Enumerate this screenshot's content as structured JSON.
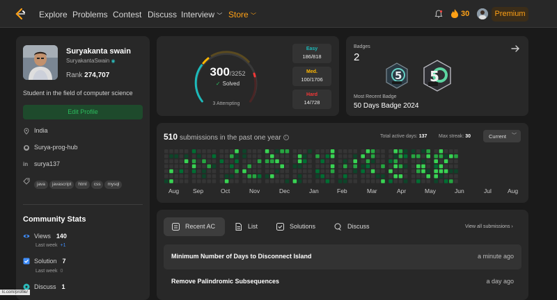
{
  "nav": {
    "links": [
      "Explore",
      "Problems",
      "Contest",
      "Discuss",
      "Interview",
      "Store"
    ],
    "streak": "30",
    "premium": "Premium"
  },
  "profile": {
    "name": "Suryakanta swain",
    "username": "SuryakantaSwain",
    "rank_label": "Rank",
    "rank": "274,707",
    "bio": "Student in the field of computer science",
    "edit_label": "Edit Profile",
    "location": "India",
    "github": "Surya-prog-hub",
    "linkedin": "surya137",
    "skills": [
      "java",
      "javascript",
      "html",
      "css",
      "mysql"
    ]
  },
  "community": {
    "title": "Community Stats",
    "views_label": "Views",
    "views": "140",
    "views_sub": "Last week",
    "views_delta": "+1",
    "solution_label": "Solution",
    "solution": "7",
    "solution_sub": "Last week",
    "solution_delta": "0",
    "discuss_label": "Discuss",
    "discuss": "1"
  },
  "solved": {
    "count": "300",
    "total": "/3252",
    "label": "Solved",
    "attempting": "3 Attempting",
    "easy_label": "Easy",
    "easy": "186/818",
    "medium_label": "Med.",
    "medium": "100/1706",
    "hard_label": "Hard",
    "hard": "14/728"
  },
  "badges": {
    "label": "Badges",
    "count": "2",
    "recent_label": "Most Recent Badge",
    "recent": "50 Days Badge 2024"
  },
  "submissions": {
    "count": "510",
    "label": "submissions in the past one year",
    "active_days_label": "Total active days:",
    "active_days": "137",
    "max_streak_label": "Max streak:",
    "max_streak": "30",
    "range": "Current",
    "months": [
      "Aug",
      "Sep",
      "Oct",
      "Nov",
      "Dec",
      "Jan",
      "Feb",
      "Mar",
      "Apr",
      "May",
      "Jun",
      "Jul",
      "Aug"
    ]
  },
  "recent": {
    "tabs": [
      "Recent AC",
      "List",
      "Solutions",
      "Discuss"
    ],
    "view_all": "View all submissions",
    "items": [
      {
        "title": "Minimum Number of Days to Disconnect Island",
        "time": "a minute ago"
      },
      {
        "title": "Remove Palindromic Subsequences",
        "time": "a day ago"
      }
    ]
  },
  "status_url": "lc.com/profile/",
  "colors": {
    "easy": "#1cbaba",
    "medium": "#ffb700",
    "hard": "#f63737",
    "accent": "#ffa116",
    "green": "#2cbb5d"
  }
}
